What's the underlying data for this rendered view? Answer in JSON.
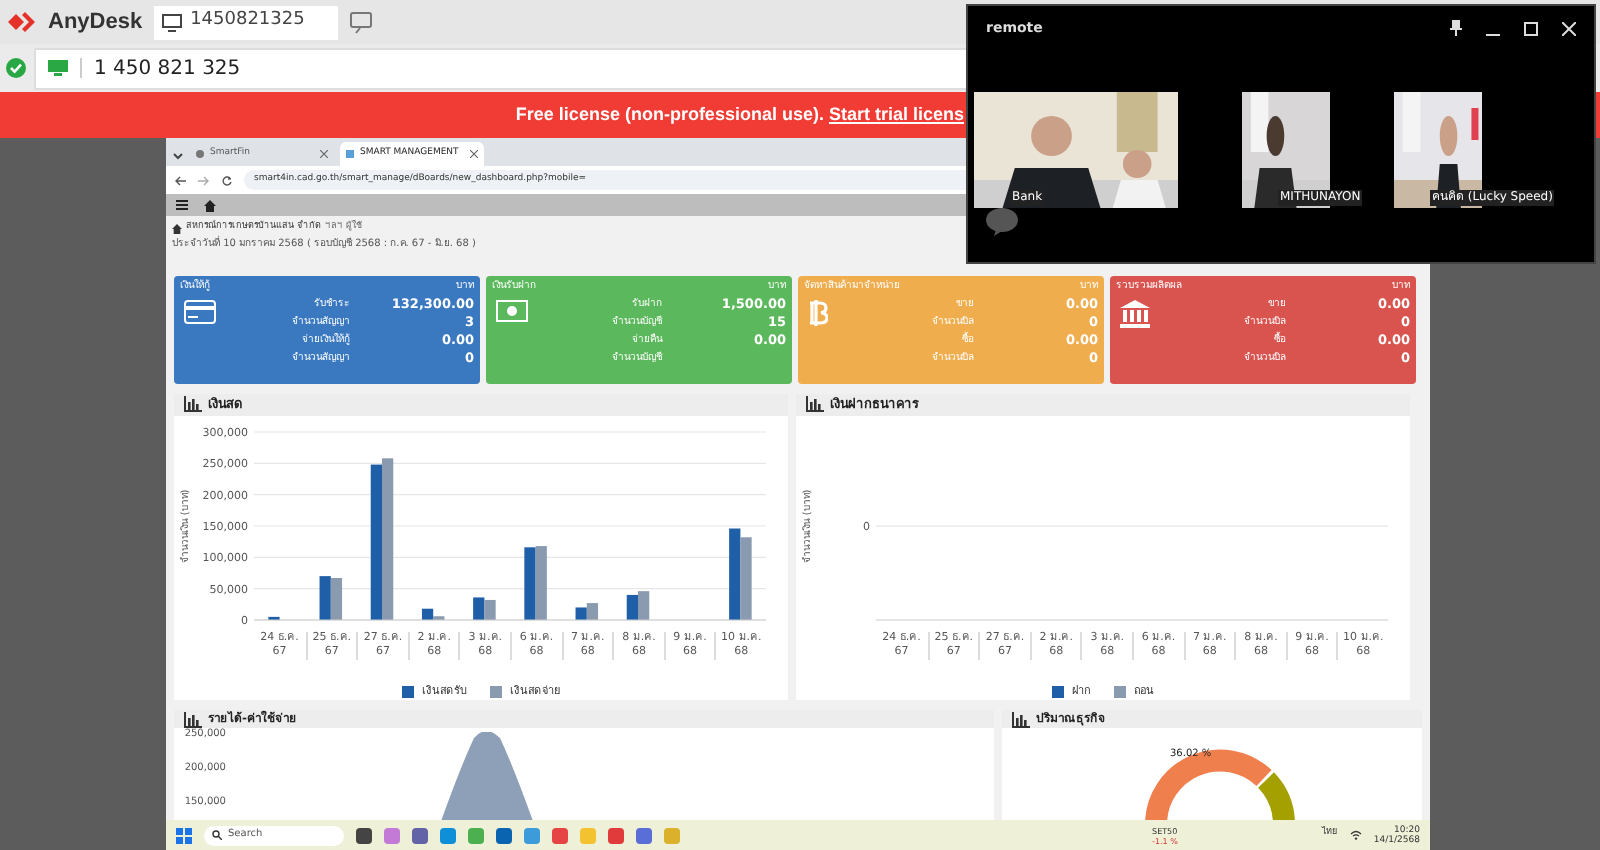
{
  "anydesk": {
    "app_name": "AnyDesk",
    "tab_label": "1450821325",
    "address": "1 450 821 325",
    "banner_text": "Free license (non-professional use). ",
    "banner_link": "Start trial licens"
  },
  "remote_window": {
    "title": "remote",
    "participants": [
      {
        "name": "Bank"
      },
      {
        "name": "MITHUNAYON"
      },
      {
        "name": "คนคิด (Lucky Speed)"
      }
    ]
  },
  "browser": {
    "tabs": [
      {
        "label": "SmartFin",
        "selected": false
      },
      {
        "label": "SMART MANAGEMENT",
        "selected": true
      }
    ],
    "url": "smart4in.cad.go.th/smart_manage/dBoards/new_dashboard.php?mobile="
  },
  "header": {
    "org": "สหกรณ์การเกษตรบ้านแสน จำกัด",
    "user": "ฯลฯ ผู้ใช้",
    "date_line": "ประจำวันที่ 10 มกราคม 2568 ( รอบบัญชี 2568 : ก.ค. 67 - มิ.ย. 68 )"
  },
  "cards": [
    {
      "title": "เงินให้กู้",
      "unit": "บาท",
      "color": "#3a78c0",
      "kind": "card",
      "rows": [
        {
          "label": "รับชำระ",
          "value": "132,300.00"
        },
        {
          "label": "จำนวนสัญญา",
          "value": "3"
        },
        {
          "label": "จ่ายเงินให้กู้",
          "value": "0.00"
        },
        {
          "label": "จำนวนสัญญา",
          "value": "0"
        }
      ]
    },
    {
      "title": "เงินรับฝาก",
      "unit": "บาท",
      "color": "#5cb85c",
      "kind": "money",
      "rows": [
        {
          "label": "รับฝาก",
          "value": "1,500.00"
        },
        {
          "label": "จำนวนบัญชี",
          "value": "15"
        },
        {
          "label": "จ่ายคืน",
          "value": "0.00"
        },
        {
          "label": "จำนวนบัญชี"
        }
      ]
    },
    {
      "title": "จัดหาสินค้ามาจำหน่าย",
      "unit": "บาท",
      "color": "#f0ad4e",
      "kind": "coin",
      "rows": [
        {
          "label": "ขาย",
          "value": "0.00"
        },
        {
          "label": "จำนวนบิล",
          "value": "0"
        },
        {
          "label": "ซื้อ",
          "value": "0.00"
        },
        {
          "label": "จำนวนบิล",
          "value": "0"
        }
      ]
    },
    {
      "title": "รวบรวมผลิตผล",
      "unit": "บาท",
      "color": "#d9534f",
      "kind": "bank",
      "rows": [
        {
          "label": "ขาย",
          "value": "0.00"
        },
        {
          "label": "จำนวนบิล",
          "value": "0"
        },
        {
          "label": "ซื้อ",
          "value": "0.00"
        },
        {
          "label": "จำนวนบิล",
          "value": "0"
        }
      ]
    }
  ],
  "panels": [
    {
      "title": "เงินสด",
      "chart_data": {
        "type": "bar",
        "ylabel": "จำนวนเงิน (บาท)",
        "grid": true,
        "legend": true,
        "categories": [
          "24 ธ.ค. 67",
          "25 ธ.ค. 67",
          "27 ธ.ค. 67",
          "2 ม.ค. 68",
          "3 ม.ค. 68",
          "6 ม.ค. 68",
          "7 ม.ค. 68",
          "8 ม.ค. 68",
          "9 ม.ค. 68",
          "10 ม.ค. 68"
        ],
        "ylim": [
          0,
          300000
        ],
        "yticks": [
          {
            "value": 0,
            "label": "0"
          },
          {
            "value": 50000,
            "label": "50,000"
          },
          {
            "value": 100000,
            "label": "100,000"
          },
          {
            "value": 150000,
            "label": "150,000"
          },
          {
            "value": 200000,
            "label": "200,000"
          },
          {
            "value": 250000,
            "label": "250,000"
          },
          {
            "value": 300000,
            "label": "300,000"
          }
        ],
        "series": [
          {
            "name": "เงินสดรับ",
            "color": "#1f5fa8",
            "values": [
              5000,
              70000,
              248000,
              18000,
              36000,
              116000,
              20000,
              40000,
              0,
              146000
            ]
          },
          {
            "name": "เงินสดจ่าย",
            "color": "#8a9bb0",
            "values": [
              0,
              67000,
              258000,
              6000,
              32000,
              118000,
              27000,
              46000,
              0,
              132000
            ]
          }
        ]
      }
    },
    {
      "title": "เงินฝากธนาคาร",
      "empty_chart": {
        "ylabel": "จำนวนเงิน (บาท)",
        "zero_label": "0",
        "categories": [
          "24 ธ.ค. 67",
          "25 ธ.ค. 67",
          "27 ธ.ค. 67",
          "2 ม.ค. 68",
          "3 ม.ค. 68",
          "6 ม.ค. 68",
          "7 ม.ค. 68",
          "8 ม.ค. 68",
          "9 ม.ค. 68",
          "10 ม.ค. 68"
        ],
        "legend": [
          {
            "name": "ฝาก",
            "color": "#1f5fa8"
          },
          {
            "name": "ถอน",
            "color": "#8a9bb0"
          }
        ]
      }
    }
  ],
  "bottom_panels": [
    {
      "title": "รายได้-ค่าใช้จ่าย",
      "y_tick_labels": [
        "250,000",
        "200,000",
        "150,000"
      ]
    },
    {
      "title": "ปริมาณธุรกิจ",
      "slice_label": "36.02 %"
    }
  ],
  "taskbar": {
    "search": "Search",
    "stock_name": "SET50",
    "stock_change": "-1.1 %",
    "lang": "ไทย",
    "time": "10:20",
    "date": "14/1/2568"
  }
}
